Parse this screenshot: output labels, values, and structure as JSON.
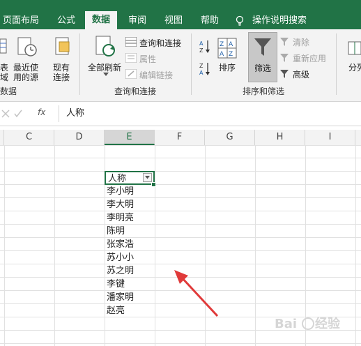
{
  "tabs": [
    "页面布局",
    "公式",
    "数据",
    "审阅",
    "视图",
    "帮助"
  ],
  "active_tab": "数据",
  "help_search": "操作说明搜索",
  "ribbon": {
    "get_data_partial": {
      "line1": "表",
      "line2": "域"
    },
    "recent_sources": {
      "line1": "最近使",
      "line2": "用的源"
    },
    "existing": {
      "line1": "现有",
      "line2": "连接"
    },
    "get_group_label": "数据",
    "refresh_all": "全部刷新",
    "queries_connections": "查询和连接",
    "properties": "属性",
    "edit_links": "编辑链接",
    "query_group_label": "查询和连接",
    "sort": "排序",
    "filter": "筛选",
    "clear": "清除",
    "reapply": "重新应用",
    "advanced": "高级",
    "sort_group_label": "排序和筛选",
    "split_partial": "分列"
  },
  "formula_bar": {
    "fx": "fx",
    "value": "人称"
  },
  "columns": [
    "C",
    "D",
    "E",
    "F",
    "G",
    "H",
    "I"
  ],
  "selected_column": "E",
  "cells": {
    "header": "人称",
    "names": [
      "李小明",
      "李大明",
      "李明亮",
      "陈明",
      "张家浩",
      "苏小小",
      "苏之明",
      "李键",
      "潘家明",
      "赵亮"
    ]
  },
  "colors": {
    "accent": "#217346",
    "arrow": "#e03a3a"
  },
  "watermark": "Baidu 经验"
}
